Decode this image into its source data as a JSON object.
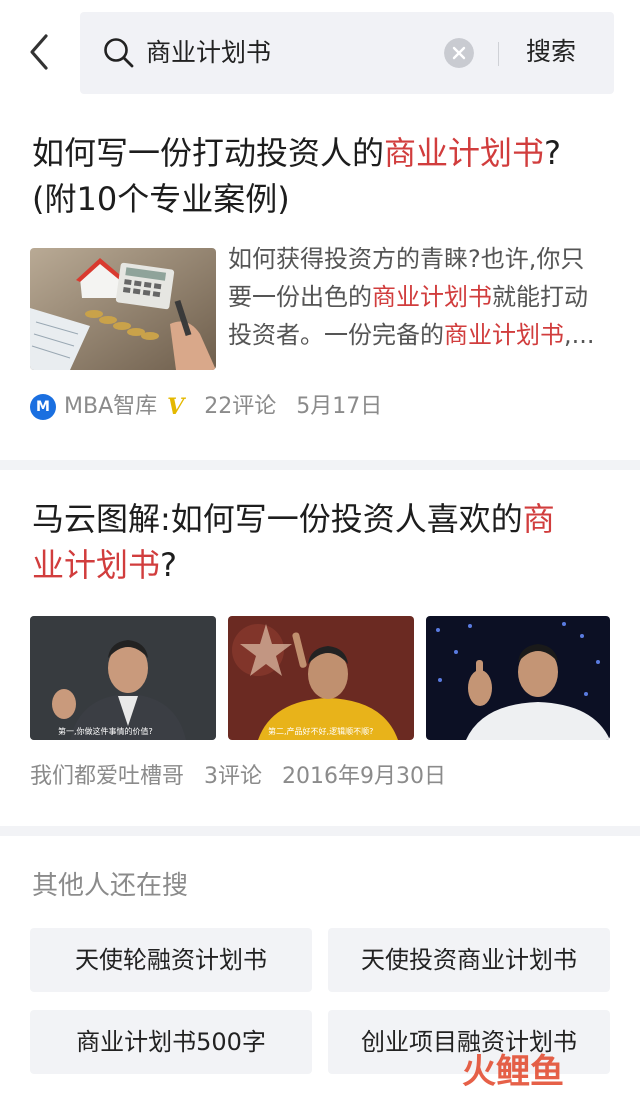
{
  "search": {
    "query": "商业计划书",
    "button_label": "搜索"
  },
  "articles": [
    {
      "title_parts": [
        "如何写一份打动投资人的",
        "商业计划书",
        "?"
      ],
      "title_line2": "(附10个专业案例)",
      "snippet_parts": [
        "如何获得投资方的青睐?也许,你只要一份出色的",
        "商业计划书",
        "就能打动投资者。一份完备的",
        "商业计划书",
        ",..."
      ],
      "source": "MBA智库",
      "source_badge": "V",
      "logo_letter": "M",
      "comments": "22评论",
      "date": "5月17日"
    },
    {
      "title_parts": [
        "马云图解:如何写一份投资人喜欢的",
        "商",
        "业计划书",
        "?"
      ],
      "image_captions": [
        "第一,你做这件事情的价值?",
        "第二,产品好不好,逻辑顺不顺?",
        ""
      ],
      "source": "我们都爱吐槽哥",
      "comments": "3评论",
      "date": "2016年9月30日"
    }
  ],
  "related": {
    "title": "其他人还在搜",
    "items": [
      "天使轮融资计划书",
      "天使投资商业计划书",
      "商业计划书500字",
      "创业项目融资计划书"
    ]
  },
  "watermark": "火鲤鱼",
  "colors": {
    "highlight": "#d13d3d",
    "brand_blue": "#1a6fe0",
    "verified_yellow": "#e4b800"
  }
}
